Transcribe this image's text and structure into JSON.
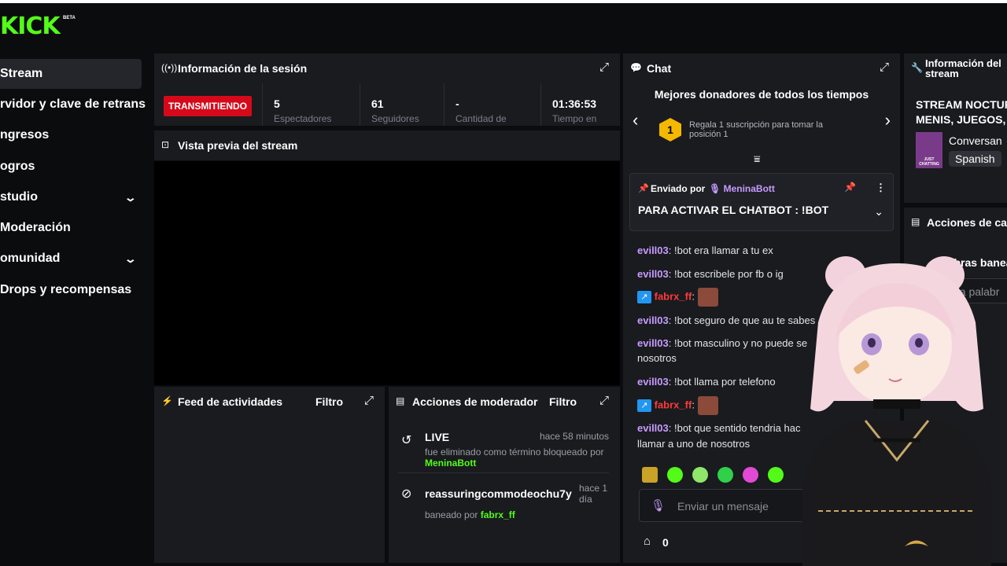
{
  "logo": {
    "text": "KICK",
    "beta": "BETA"
  },
  "sidebar": {
    "items": [
      {
        "label": "Stream",
        "active": true
      },
      {
        "label": "Servidor y clave de retransmisión"
      },
      {
        "label": "Ingresos"
      },
      {
        "label": "Logros"
      },
      {
        "label": "Estudio",
        "chevron": "chevron-down-icon"
      },
      {
        "label": "Moderación"
      },
      {
        "label": "Comunidad",
        "chevron": "chevron-down-icon"
      },
      {
        "label": "Drops y recompensas"
      }
    ],
    "visible_labels": [
      "Stream",
      "rvidor y clave de retransm",
      "ngresos",
      "ogros",
      "studio",
      "Moderación",
      "omunidad",
      "Drops y recompensas"
    ]
  },
  "session": {
    "title": "Información de la sesión",
    "status": "TRANSMITIENDO",
    "stats": [
      {
        "value": "5",
        "label": "Espectadores"
      },
      {
        "value": "61",
        "label": "Seguidores"
      },
      {
        "value": "-",
        "label": "Cantidad de"
      },
      {
        "value": "01:36:53",
        "label": "Tiempo en"
      }
    ]
  },
  "preview": {
    "title": "Vista previa del stream"
  },
  "feed": {
    "title": "Feed de actividades",
    "filter": "Filtro"
  },
  "modactions": {
    "title": "Acciones de moderador",
    "filter": "Filtro",
    "entries": [
      {
        "name": "LIVE",
        "time": "hace 58 minutos",
        "desc": "fue eliminado como término bloqueado",
        "by_prefix": "por",
        "by": "MeninaBott",
        "icon": "history-icon"
      },
      {
        "name": "reassuringcommodeochu7y",
        "time": "hace 1 día",
        "desc": "baneado por",
        "by": "fabrx_ff",
        "icon": "ban-icon"
      }
    ]
  },
  "chat": {
    "title": "Chat",
    "donors_title": "Mejores donadores de todos los tiempos",
    "donor_rank": "1",
    "donor_text": "Regala 1 suscripción para tomar la posición 1",
    "pinned": {
      "prefix": "Enviado por",
      "user": "MeninaBott",
      "message": "PARA ACTIVAR EL CHATBOT : !BOT"
    },
    "messages": [
      {
        "user": "evill03",
        "text": ": !bot era llamar a tu ex"
      },
      {
        "user": "evill03",
        "text": ": !bot escribele por fb o ig"
      },
      {
        "user": "fabrx_ff",
        "text": ":",
        "badge": true,
        "emote": true
      },
      {
        "user": "evill03",
        "text": ": !bot seguro de que au te sabes"
      },
      {
        "user": "evill03",
        "text": ": !bot masculino y no puede se"
      },
      {
        "user": "",
        "text": "nosotros"
      },
      {
        "user": "evill03",
        "text": ": !bot llama por telefono"
      },
      {
        "user": "fabrx_ff",
        "text": ":",
        "badge": true,
        "emote": true
      },
      {
        "user": "evill03",
        "text": ": !bot que sentido tendria hac"
      },
      {
        "user": "",
        "text": "llamar a uno de nosotros"
      }
    ],
    "input_placeholder": "Enviar un mensaje",
    "points": "0"
  },
  "streaminfo": {
    "title": "Información del stream",
    "title_line1": "Información del",
    "title_line2": "stream",
    "stream_title_1": "STREAM NOCTUR",
    "stream_title_2": "MENIS, JUEGOS,",
    "category": "Conversan",
    "category_thumb": "JUST CHATTING",
    "language": "Spanish"
  },
  "channelactions": {
    "title": "Acciones de ca",
    "banned_words": "alabras banea",
    "input_placeholder": "sa la palabr"
  },
  "colors": {
    "brand": "#53fc18",
    "live": "#d6091b",
    "panel": "#191b1f",
    "username": "#c79bff"
  }
}
